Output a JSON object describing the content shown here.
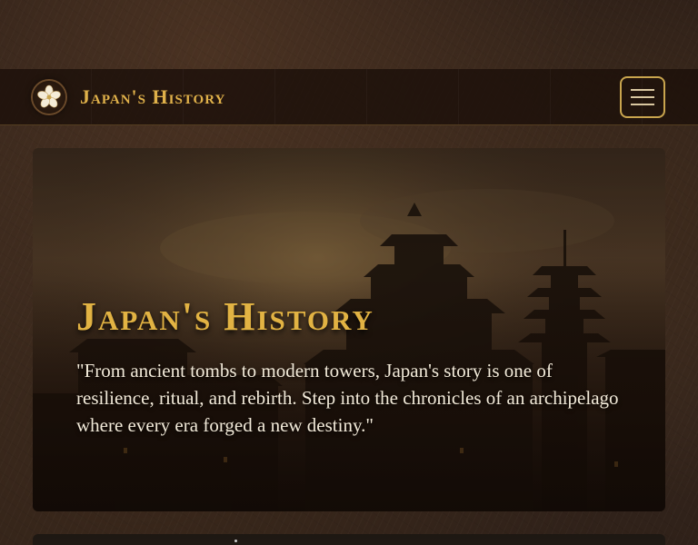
{
  "nav": {
    "brand": "Japan's History",
    "logo_icon": "sakura-crest-icon",
    "menu_icon": "hamburger-menu-icon"
  },
  "hero": {
    "title": "Japan's History",
    "quote": "\"From ancient tombs to modern towers, Japan's story is one of resilience, ritual, and rebirth. Step into the chronicles of an archipelago where every era forged a new destiny.\""
  },
  "colors": {
    "accent_gold": "#e2b343",
    "nav_bg": "#1c100a",
    "text_light": "#f2ead9"
  }
}
